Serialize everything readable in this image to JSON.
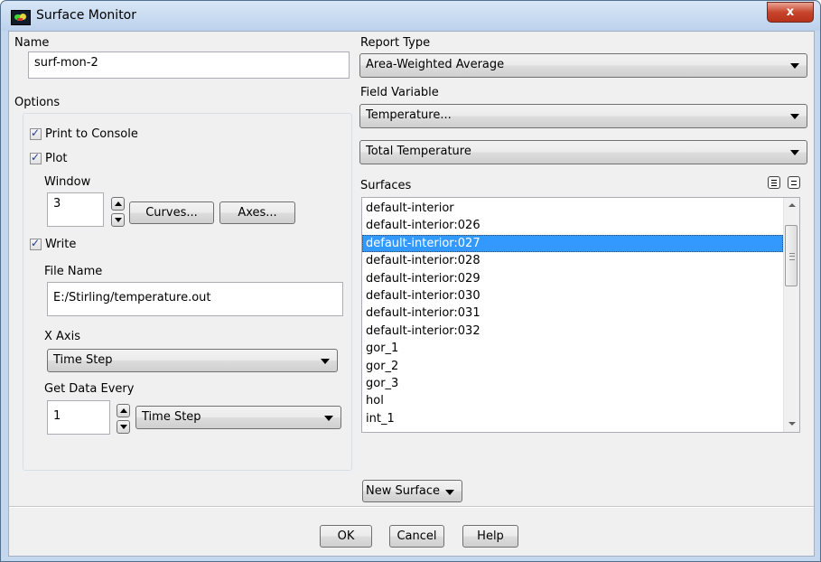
{
  "window": {
    "title": "Surface Monitor",
    "close_label": "x"
  },
  "name": {
    "label": "Name",
    "value": "surf-mon-2"
  },
  "options": {
    "label": "Options",
    "print_to_console": {
      "label": "Print to Console",
      "checked": true
    },
    "plot": {
      "label": "Plot",
      "checked": true
    },
    "window": {
      "label": "Window",
      "value": "3"
    },
    "curves_button": "Curves...",
    "axes_button": "Axes...",
    "write": {
      "label": "Write",
      "checked": true
    },
    "file_name": {
      "label": "File Name",
      "value": "E:/Stirling/temperature.out"
    },
    "x_axis": {
      "label": "X Axis",
      "value": "Time Step"
    },
    "get_data_every": {
      "label": "Get Data Every",
      "value": "1",
      "unit": "Time Step"
    }
  },
  "report_type": {
    "label": "Report Type",
    "value": "Area-Weighted Average"
  },
  "field_variable": {
    "label": "Field Variable",
    "category": "Temperature...",
    "variable": "Total Temperature"
  },
  "surfaces": {
    "label": "Surfaces",
    "items": [
      "default-interior",
      "default-interior:026",
      "default-interior:027",
      "default-interior:028",
      "default-interior:029",
      "default-interior:030",
      "default-interior:031",
      "default-interior:032",
      "gor_1",
      "gor_2",
      "gor_3",
      "hol",
      "int_1"
    ],
    "selected_index": 2
  },
  "new_surface_button": "New Surface",
  "footer": {
    "ok": "OK",
    "cancel": "Cancel",
    "help": "Help"
  }
}
